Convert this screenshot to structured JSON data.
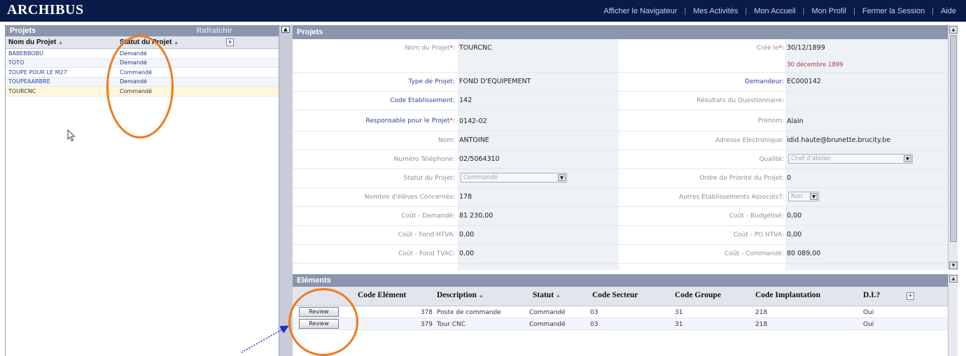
{
  "app": {
    "logo": "ARCHIBUS"
  },
  "topnav": [
    "Afficher le Navigateur",
    "Mes Activités",
    "Mon Accueil",
    "Mon Profil",
    "Fermer la Session",
    "Aide"
  ],
  "left": {
    "title": "Projets",
    "refresh": "Rafraîchir",
    "col_name": "Nom du  Projet",
    "col_status": "Statut du Projet",
    "rows": [
      {
        "name": "BABEBBOBU",
        "status": "Demandé"
      },
      {
        "name": "TOTO",
        "status": "Demandé"
      },
      {
        "name": "TOUPE POUR LE M27",
        "status": "Commandé"
      },
      {
        "name": "TOUPEAARBRE",
        "status": "Demandé"
      },
      {
        "name": "TOURCNC",
        "status": "Commandé"
      }
    ]
  },
  "form": {
    "title": "Projets",
    "nom_label": "Nom du Projet",
    "nom": "TOURCNC",
    "cree_label": "Créé le",
    "cree": "30/12/1899",
    "cree_long": "30 décembre 1899",
    "type_label": "Type de Projet:",
    "type": "FOND D'EQUIPEMENT",
    "demandeur_label": "Demandeur:",
    "demandeur": "EC000142",
    "code_label": "Code Etablissement:",
    "code": "142",
    "resultats_label": "Résultats du Questionnaire:",
    "responsable_label": "Responsable pour le Projet",
    "responsable": "0142-02",
    "prenom_label": "Prénom:",
    "prenom": "Alain",
    "nom2_label": "Nom:",
    "nom2": "ANTOINE",
    "email_label": "Adresse Electronique:",
    "email": "idid.haute@brunette.brucity.be",
    "tel_label": "Numéro Téléphone:",
    "tel": "02/5064310",
    "qualite_label": "Qualité:",
    "qualite": "Chef d'atelier",
    "statut_label": "Statut du Projet:",
    "statut": "Commandé",
    "priorite_label": "Ordre de Priorité du Projet:",
    "priorite": "0",
    "eleves_label": "Nombre d'élèves Concernés:",
    "eleves": "178",
    "autres_label": "Autres Etablissements Associés?:",
    "autres": "Non",
    "cout_demande_label": "Coût - Demandé:",
    "cout_demande": "81 230,00",
    "cout_budget_label": "Coût - Budgétisé:",
    "cout_budget": "0,00",
    "fond_htva_label": "Coût - Fond HTVA:",
    "fond_htva": "0,00",
    "po_htva_label": "Coût - PO HTVA:",
    "po_htva": "0,00",
    "fond_tvac_label": "Coût - Fond TVAC:",
    "fond_tvac": "0,00",
    "commande_label": "Coût - Commandé:",
    "commande": "80 089,00",
    "req_mark": "*:"
  },
  "elements": {
    "title": "Eléments",
    "cols": [
      "Code  Elément",
      "Description",
      "Statut",
      "Code Secteur",
      "Code Groupe",
      "Code Implantation",
      "D.I.?"
    ],
    "review_label": "Review",
    "rows": [
      {
        "code": "378",
        "desc": "Poste de commande",
        "statut": "Commandé",
        "secteur": "03",
        "groupe": "31",
        "impl": "218",
        "di": "Oui"
      },
      {
        "code": "379",
        "desc": "Tour CNC",
        "statut": "Commandé",
        "secteur": "03",
        "groupe": "31",
        "impl": "218",
        "di": "Oui"
      }
    ]
  },
  "colors": {
    "header": "#0a1b4a",
    "panel": "#8b95ad",
    "annotation": "#ef7a1a",
    "selected": "#fff6dc"
  }
}
